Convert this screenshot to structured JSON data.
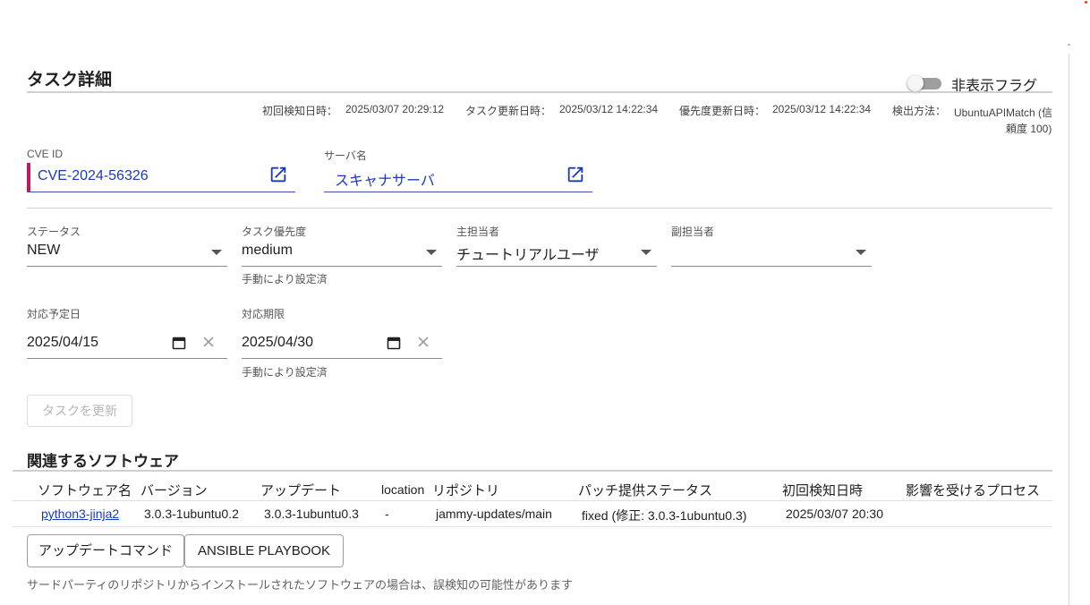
{
  "header": {
    "title": "タスク詳細",
    "toggle_label": "非表示フラグ"
  },
  "meta": {
    "first_detected_label": "初回検知日時：",
    "first_detected_value": "2025/03/07 20:29:12",
    "task_updated_label": "タスク更新日時：",
    "task_updated_value": "2025/03/12 14:22:34",
    "priority_updated_label": "優先度更新日時：",
    "priority_updated_value": "2025/03/12 14:22:34",
    "detection_label": "検出方法：",
    "detection_value_line1": "UbuntuAPIMatch (信",
    "detection_value_line2": "頼度 100)"
  },
  "fields": {
    "cve_label": "CVE ID",
    "cve_value": "CVE-2024-56326",
    "server_label": "サーバ名",
    "server_value": "スキャナサーバ",
    "status_label": "ステータス",
    "status_value": "NEW",
    "priority_label": "タスク優先度",
    "priority_value": "medium",
    "priority_helper": "手動により設定済",
    "assignee_label": "主担当者",
    "assignee_value": "チュートリアルユーザ",
    "sub_assignee_label": "副担当者",
    "sub_assignee_value": "",
    "planned_date_label": "対応予定日",
    "planned_date_value": "2025/04/15",
    "due_date_label": "対応期限",
    "due_date_value": "2025/04/30",
    "due_date_helper": "手動により設定済"
  },
  "actions": {
    "update_task_label": "タスクを更新"
  },
  "software": {
    "section_title": "関連するソフトウェア",
    "headers": [
      "ソフトウェア名",
      "バージョン",
      "アップデート",
      "location",
      "リポジトリ",
      "パッチ提供ステータス",
      "初回検知日時",
      "影響を受けるプロセス"
    ],
    "rows": [
      {
        "name": "python3-jinja2",
        "version": "3.0.3-1ubuntu0.2",
        "update": "3.0.3-1ubuntu0.3",
        "location": "-",
        "repository": "jammy-updates/main",
        "patch_status": "fixed (修正: 3.0.3-1ubuntu0.3)",
        "first_detected": "2025/03/07 20:30",
        "processes": ""
      }
    ],
    "update_command_label": "アップデートコマンド",
    "ansible_label": "ANSIBLE PLAYBOOK",
    "note": "サードパーティのリポジトリからインストールされたソフトウェアの場合は、誤検知の可能性があります"
  },
  "icons": {
    "external_link": "open-in-new-icon",
    "dropdown": "arrow-drop-down-icon",
    "calendar": "calendar-icon",
    "clear": "close-icon"
  },
  "colors": {
    "link": "#1a3ab8",
    "cve_accent": "#c2185b",
    "underline_focus": "#3f51b5"
  }
}
